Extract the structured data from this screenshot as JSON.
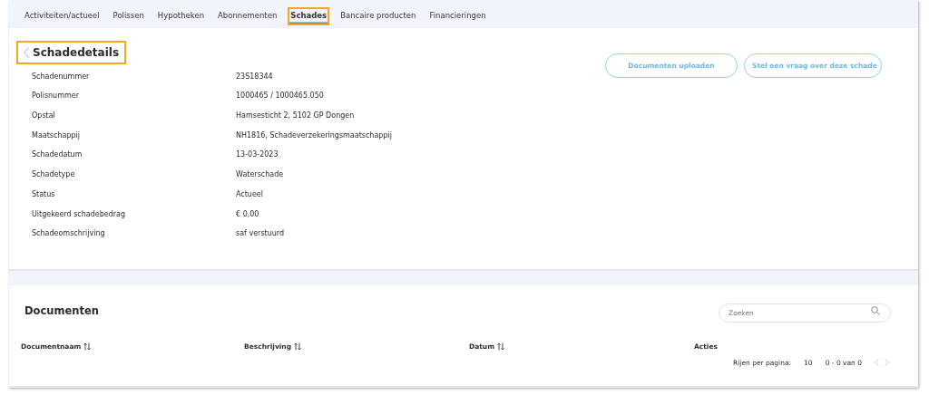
{
  "tabs": [
    {
      "label": "Activiteiten/actueel",
      "selected": false,
      "highlighted": false
    },
    {
      "label": "Polissen",
      "selected": false,
      "highlighted": false
    },
    {
      "label": "Hypotheken",
      "selected": false,
      "highlighted": false
    },
    {
      "label": "Abonnementen",
      "selected": false,
      "highlighted": false
    },
    {
      "label": "Schades",
      "selected": true,
      "highlighted": true
    },
    {
      "label": "Bancaire producten",
      "selected": false,
      "highlighted": false
    },
    {
      "label": "Financieringen",
      "selected": false,
      "highlighted": false
    }
  ],
  "details": {
    "title": "Schadedetails",
    "title_highlighted": true,
    "buttons": [
      "Documenten uploaden",
      "Stel een vraag over deze schade"
    ],
    "rows": [
      {
        "label": "Schadenummer",
        "value": "23S18344"
      },
      {
        "label": "Polisnummer",
        "value": "1000465 / 1000465.050"
      },
      {
        "label": "Opstal",
        "value": "Hamsesticht 2, 5102 GP Dongen"
      },
      {
        "label": "Maatschappij",
        "value": "NH1816, Schadeverzekeringsmaatschappij"
      },
      {
        "label": "Schadedatum",
        "value": "13-03-2023"
      },
      {
        "label": "Schadetype",
        "value": "Waterschade"
      },
      {
        "label": "Status",
        "value": "Actueel"
      },
      {
        "label": "Uitgekeerd schadebedrag",
        "value": "€ 0,00"
      },
      {
        "label": "Schadeomschrijving",
        "value": "saf verstuurd"
      }
    ]
  },
  "documents": {
    "title": "Documenten",
    "search": {
      "placeholder": "Zoeken"
    },
    "columns": [
      {
        "label": "Documentnaam",
        "sortable": true
      },
      {
        "label": "Beschrijving",
        "sortable": true
      },
      {
        "label": "Datum",
        "sortable": true
      },
      {
        "label": "Acties",
        "sortable": false
      }
    ],
    "pagination": {
      "label": "Rijen per pagina:",
      "per_page": "10",
      "range": "0 - 0 van 0",
      "prev_disabled": true,
      "next_disabled": true
    }
  }
}
